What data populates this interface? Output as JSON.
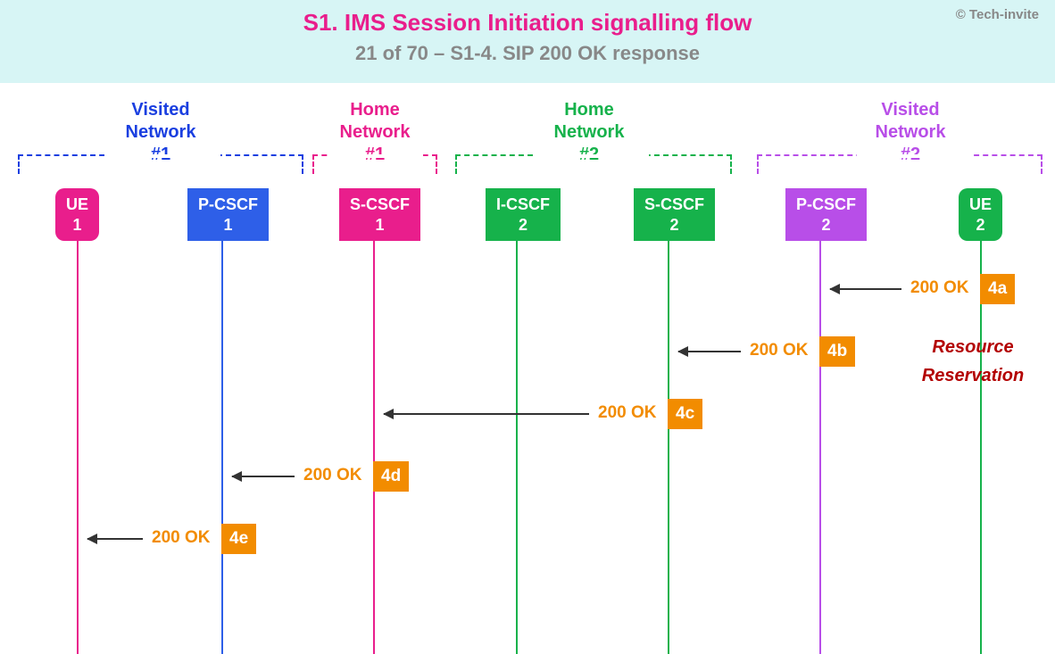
{
  "copyright": "© Tech-invite",
  "title": "S1. IMS Session Initiation signalling flow",
  "subtitle": "21 of 70 – S1-4. SIP 200 OK response",
  "networks": {
    "visited1": {
      "label": "Visited\nNetwork\n#1",
      "color": "#1a3fe0"
    },
    "home1": {
      "label": "Home\nNetwork\n#1",
      "color": "#e91e8c"
    },
    "home2": {
      "label": "Home\nNetwork\n#2",
      "color": "#16b24b"
    },
    "visited2": {
      "label": "Visited\nNetwork\n#2",
      "color": "#b84ee8"
    }
  },
  "nodes": {
    "ue1": {
      "label": "UE\n1",
      "color": "#e91e8c"
    },
    "pcscf1": {
      "label": "P-CSCF\n1",
      "color": "#2e5fe8"
    },
    "scscf1": {
      "label": "S-CSCF\n1",
      "color": "#e91e8c"
    },
    "icscf2": {
      "label": "I-CSCF\n2",
      "color": "#16b24b"
    },
    "scscf2": {
      "label": "S-CSCF\n2",
      "color": "#16b24b"
    },
    "pcscf2": {
      "label": "P-CSCF\n2",
      "color": "#b84ee8"
    },
    "ue2": {
      "label": "UE\n2",
      "color": "#16b24b"
    }
  },
  "messages": {
    "m4a": {
      "text": "200 OK",
      "badge": "4a"
    },
    "m4b": {
      "text": "200 OK",
      "badge": "4b"
    },
    "m4c": {
      "text": "200 OK",
      "badge": "4c"
    },
    "m4d": {
      "text": "200 OK",
      "badge": "4d"
    },
    "m4e": {
      "text": "200 OK",
      "badge": "4e"
    }
  },
  "annotation": "Resource\nReservation",
  "chart_data": {
    "type": "sequence-diagram",
    "title": "S1. IMS Session Initiation signalling flow",
    "subtitle": "21 of 70 – S1-4. SIP 200 OK response",
    "groups": [
      {
        "name": "Visited Network #1",
        "participants": [
          "UE 1",
          "P-CSCF 1"
        ]
      },
      {
        "name": "Home Network #1",
        "participants": [
          "S-CSCF 1"
        ]
      },
      {
        "name": "Home Network #2",
        "participants": [
          "I-CSCF 2",
          "S-CSCF 2"
        ]
      },
      {
        "name": "Visited Network #2",
        "participants": [
          "P-CSCF 2",
          "UE 2"
        ]
      }
    ],
    "participants": [
      "UE 1",
      "P-CSCF 1",
      "S-CSCF 1",
      "I-CSCF 2",
      "S-CSCF 2",
      "P-CSCF 2",
      "UE 2"
    ],
    "messages": [
      {
        "id": "4a",
        "from": "UE 2",
        "to": "P-CSCF 2",
        "label": "200 OK"
      },
      {
        "id": "4b",
        "from": "P-CSCF 2",
        "to": "S-CSCF 2",
        "label": "200 OK"
      },
      {
        "id": "4c",
        "from": "S-CSCF 2",
        "to": "S-CSCF 1",
        "label": "200 OK"
      },
      {
        "id": "4d",
        "from": "S-CSCF 1",
        "to": "P-CSCF 1",
        "label": "200 OK"
      },
      {
        "id": "4e",
        "from": "P-CSCF 1",
        "to": "UE 1",
        "label": "200 OK"
      }
    ],
    "annotations": [
      {
        "near": "UE 2",
        "afterMessage": "4a",
        "text": "Resource Reservation"
      }
    ]
  }
}
